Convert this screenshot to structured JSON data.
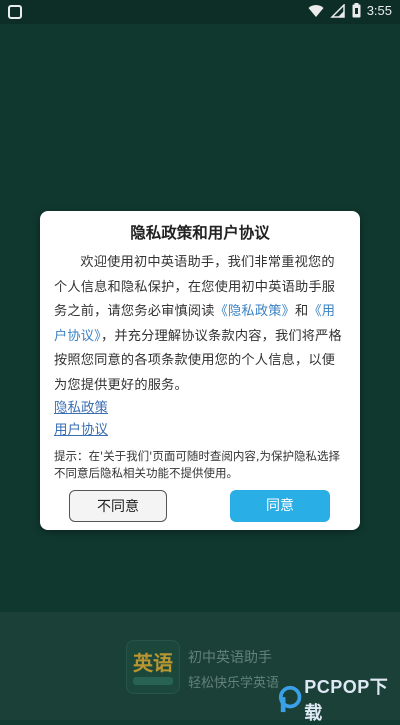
{
  "statusbar": {
    "time": "3:55",
    "icons": [
      "wifi-icon",
      "cellular-signal-icon",
      "battery-icon"
    ]
  },
  "dialog": {
    "title": "隐私政策和用户协议",
    "body_part1": "欢迎使用初中英语助手，我们非常重视您的个人信息和隐私保护，在您使用初中英语助手服务之前，请您务必审慎阅读",
    "privacy_link_inline": "《隐私政策》",
    "body_and": "和",
    "agreement_link_inline": "《用户协议》",
    "body_part2": "，并充分理解协议条款内容，我们将严格按照您同意的各项条款使用您的个人信息，以便为您提供更好的服务。",
    "link_privacy": "隐私政策",
    "link_agreement": "用户协议",
    "tip": "提示：在'关于我们'页面可随时查阅内容,为保护隐私选择不同意后隐私相关功能不提供使用。",
    "btn_disagree": "不同意",
    "btn_agree": "同意"
  },
  "app": {
    "icon_text": "英语",
    "name": "初中英语助手",
    "slogan": "轻松快乐学英语"
  },
  "watermark": {
    "text": "PCPOP下载"
  },
  "colors": {
    "background": "#123d33",
    "agree_button": "#2aaee6",
    "link": "#3b82c4"
  }
}
